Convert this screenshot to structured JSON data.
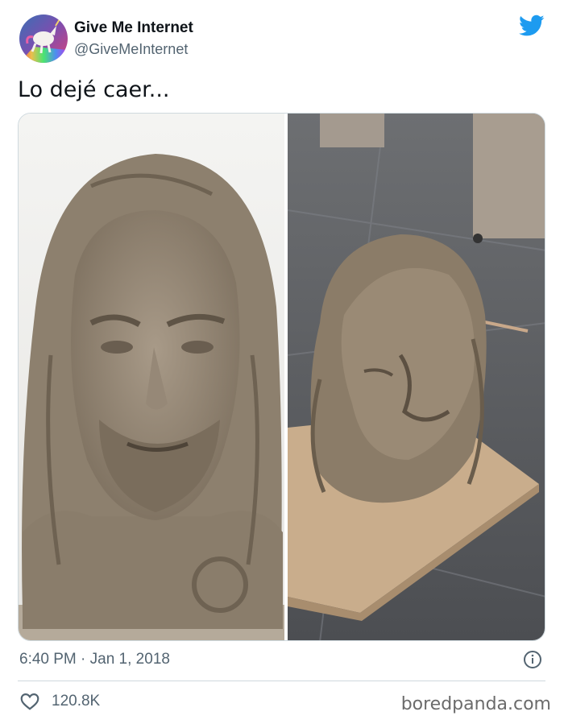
{
  "tweet": {
    "author": {
      "display_name": "Give Me Internet",
      "handle": "@GiveMeInternet",
      "avatar_icon": "unicorn-avatar"
    },
    "text": "Lo dejé caer...",
    "media": [
      {
        "subject": "clay-sculpture-bust-intact"
      },
      {
        "subject": "clay-sculpture-bust-dropped"
      }
    ],
    "timestamp": "6:40 PM · Jan 1, 2018",
    "likes": "120.8K"
  },
  "icons": {
    "brand": "twitter-bird-icon",
    "info": "info-icon",
    "like": "heart-icon"
  },
  "colors": {
    "twitter_blue": "#1d9bf0",
    "secondary_text": "#536471",
    "border": "#cfd9de"
  },
  "watermark": "boredpanda.com"
}
